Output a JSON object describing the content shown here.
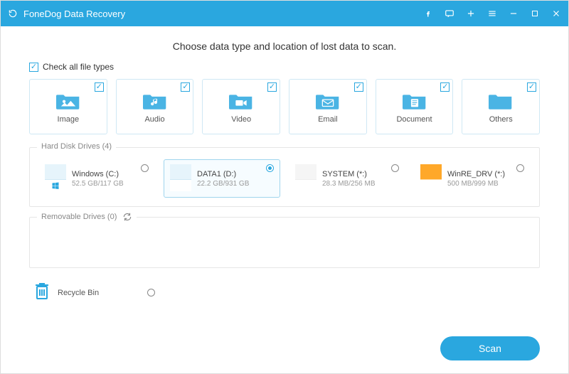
{
  "titlebar": {
    "app_name": "FoneDog Data Recovery"
  },
  "main": {
    "heading": "Choose data type and location of lost data to scan.",
    "check_all_label": "Check all file types",
    "check_all_checked": true,
    "types": [
      {
        "label": "Image",
        "icon": "image-icon",
        "checked": true
      },
      {
        "label": "Audio",
        "icon": "audio-icon",
        "checked": true
      },
      {
        "label": "Video",
        "icon": "video-icon",
        "checked": true
      },
      {
        "label": "Email",
        "icon": "email-icon",
        "checked": true
      },
      {
        "label": "Document",
        "icon": "document-icon",
        "checked": true
      },
      {
        "label": "Others",
        "icon": "others-icon",
        "checked": true
      }
    ],
    "hard_disk": {
      "legend": "Hard Disk Drives (4)",
      "drives": [
        {
          "name": "Windows (C:)",
          "size": "52.5 GB/117 GB",
          "selected": false,
          "style": "win"
        },
        {
          "name": "DATA1 (D:)",
          "size": "22.2 GB/931 GB",
          "selected": true,
          "style": "data"
        },
        {
          "name": "SYSTEM (*:)",
          "size": "28.3 MB/256 MB",
          "selected": false,
          "style": "sys"
        },
        {
          "name": "WinRE_DRV (*:)",
          "size": "500 MB/999 MB",
          "selected": false,
          "style": "orn"
        }
      ]
    },
    "removable": {
      "legend": "Removable Drives (0)"
    },
    "recycle": {
      "label": "Recycle Bin",
      "selected": false
    },
    "scan_label": "Scan"
  },
  "colors": {
    "primary": "#2aa7df",
    "orange": "#ffa829"
  }
}
